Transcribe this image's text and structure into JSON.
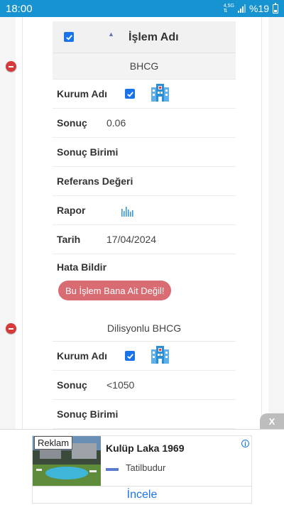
{
  "status_bar": {
    "time": "18:00",
    "network": "4,5G",
    "battery": "%19"
  },
  "table": {
    "header_title": "İşlem Adı",
    "groups": [
      {
        "name": "BHCG",
        "rows": {
          "kurum_label": "Kurum Adı",
          "sonuc_label": "Sonuç",
          "sonuc_value": "0.06",
          "birim_label": "Sonuç Birimi",
          "referans_label": "Referans Değeri",
          "rapor_label": "Rapor",
          "tarih_label": "Tarih",
          "tarih_value": "17/04/2024",
          "hata_label": "Hata Bildir",
          "not_mine_label": "Bu İşlem Bana Ait Değil!"
        }
      },
      {
        "name": "Dilisyonlu BHCG",
        "rows": {
          "kurum_label": "Kurum Adı",
          "sonuc_label": "Sonuç",
          "sonuc_value": "<1050",
          "birim_label": "Sonuç Birimi"
        }
      }
    ]
  },
  "ad": {
    "label": "Reklam",
    "title": "Kulüp Laka 1969",
    "brand": "Tatilbudur",
    "cta": "İncele",
    "close": "X",
    "info": "i"
  },
  "colors": {
    "status_bar": "#1793d1",
    "accent": "#1a73e8",
    "danger": "#d63a3a",
    "button": "#d96b73"
  }
}
